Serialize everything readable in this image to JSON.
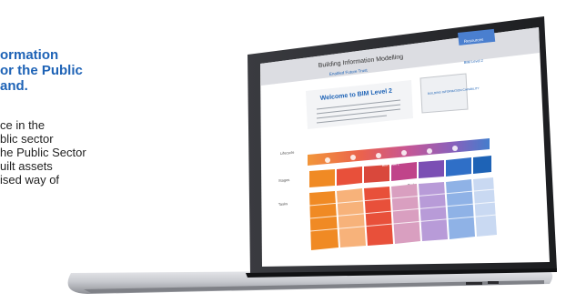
{
  "hero": {
    "title_lines": [
      "ormation",
      "or the Public",
      "and."
    ],
    "body_lines": [
      "ce in the",
      "blic sector",
      "he Public Sector",
      "uilt assets",
      "ised way of"
    ]
  },
  "screen": {
    "header_title": "Building Information Modelling",
    "header_subtitle": "Enabled Future Trust",
    "login_label": "Resources",
    "side_link": "BIM Level 2",
    "welcome_heading": "Welcome to BIM Level 2",
    "side_panel_text": "BUILDING INFORMATION CAPABILITY",
    "row_labels": [
      "Lifecycle",
      "Stages",
      "Tasks"
    ],
    "band_label": "BIM Level 2",
    "table_label": "Tasks"
  },
  "colors": {
    "accent_blue": "#1e63b6",
    "screen_bg": "#ffffff",
    "header_bg": "#dcdde2",
    "orange": "#f08a24",
    "red": "#e8503a",
    "purple": "#7b4fb4",
    "blue": "#2f6fc7",
    "pink": "#c0448a",
    "laptop_silver": "#c9cbd0",
    "laptop_dark": "#2a2a2e"
  }
}
